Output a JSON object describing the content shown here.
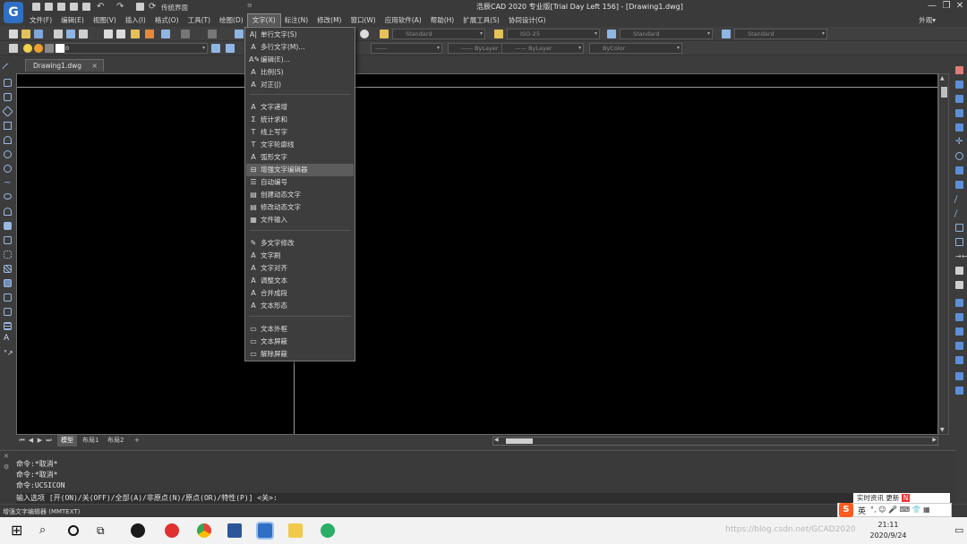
{
  "app": {
    "title": "浩辰CAD 2020 专业版[Trial Day Left 156] - [Drawing1.dwg]",
    "logo_letter": "G",
    "workspace": "传统界面",
    "appearance_menu": "外观▾"
  },
  "menubar": [
    "文件(F)",
    "编辑(E)",
    "视图(V)",
    "插入(I)",
    "格式(O)",
    "工具(T)",
    "绘图(D)",
    "文字(X)",
    "标注(N)",
    "修改(M)",
    "窗口(W)",
    "应用软件(A)",
    "帮助(H)",
    "扩展工具(S)",
    "协同设计(G)"
  ],
  "active_menu": "文字(X)",
  "toolbar": {
    "layer_value": "0",
    "combos": [
      "Standard",
      "ISO-25",
      "Standard",
      "Standard"
    ],
    "linetype": "ByLayer",
    "lineweight": "ByLayer",
    "color": "ByColor"
  },
  "document_tab": {
    "name": "Drawing1.dwg",
    "close": "×"
  },
  "text_menu": {
    "groups": [
      [
        {
          "label": "单行文字(S)",
          "icon": "AI"
        },
        {
          "label": "多行文字(M)...",
          "icon": "A"
        },
        {
          "label": "编辑(E)...",
          "icon": "A"
        },
        {
          "label": "比例(S)",
          "icon": "A"
        },
        {
          "label": "对正(J)",
          "icon": "A"
        }
      ],
      [
        {
          "label": "文字递增",
          "icon": "A"
        },
        {
          "label": "统计求和",
          "icon": "Σ"
        },
        {
          "label": "线上写字",
          "icon": "T"
        },
        {
          "label": "文字轮廓线",
          "icon": "T"
        },
        {
          "label": "弧形文字",
          "icon": "A"
        },
        {
          "label": "增强文字编辑器",
          "icon": "⊟"
        },
        {
          "label": "自动编号",
          "icon": "☰"
        },
        {
          "label": "创建动态文字",
          "icon": "▤"
        },
        {
          "label": "修改动态文字",
          "icon": "▤"
        },
        {
          "label": "文件输入",
          "icon": "▦"
        }
      ],
      [
        {
          "label": "多文字修改",
          "icon": "✎"
        },
        {
          "label": "文字刷",
          "icon": "A"
        },
        {
          "label": "文字对齐",
          "icon": "A"
        },
        {
          "label": "调整文本",
          "icon": "A"
        },
        {
          "label": "合并成段",
          "icon": "A"
        },
        {
          "label": "文本形态",
          "icon": "A"
        }
      ],
      [
        {
          "label": "文本外框",
          "icon": "▭"
        },
        {
          "label": "文本屏蔽",
          "icon": "▭"
        },
        {
          "label": "解除屏蔽",
          "icon": "▭"
        }
      ]
    ],
    "highlighted": "增强文字编辑器"
  },
  "layout_tabs": [
    "模型",
    "布局1",
    "布局2",
    "+"
  ],
  "command": {
    "lines": [
      "命令:*取消*",
      "命令:*取消*",
      "命令:UCSICON"
    ],
    "prompt": "输入选项 [开(ON)/关(OFF)/全部(A)/非原点(N)/原点(OR)/特性(P)] <关>:"
  },
  "status_text": "增强文字编辑器 (MMTEXT)",
  "ime": {
    "news": "实时资讯 更新",
    "lang": "英"
  },
  "taskbar": {
    "time": "21:11",
    "date": "2020/9/24",
    "watermark": "https://blog.csdn.net/GCAD2020"
  },
  "colors": {
    "accent": "#2f6fc4",
    "canvas": "#000000",
    "chrome": "#3c3c3c",
    "menu_highlight": "#5c5c5c"
  }
}
